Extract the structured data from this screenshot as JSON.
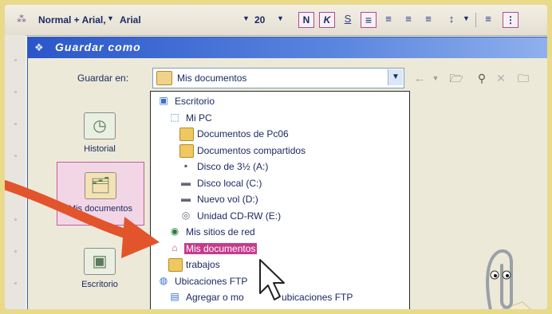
{
  "toolbar": {
    "style_label": "Normal + Arial,",
    "font_label": "Arial",
    "size_label": "20",
    "bold_label": "N",
    "italic_label": "K",
    "underline_label": "S",
    "icons": [
      "styles-icon",
      "align-left-icon",
      "align-center-icon",
      "align-right-icon",
      "justify-icon",
      "line-spacing-icon",
      "numbering-icon",
      "bullets-icon"
    ]
  },
  "dialog": {
    "title": "Guardar como",
    "save_in_label": "Guardar en:",
    "save_in_value": "Mis documentos",
    "toolbar_icons": [
      "back-icon",
      "up-folder-icon",
      "search-web-icon",
      "delete-icon",
      "new-folder-icon"
    ]
  },
  "places": [
    {
      "label": "Historial",
      "icon": "history-icon"
    },
    {
      "label": "Mis documentos",
      "icon": "my-documents-icon",
      "selected": true
    },
    {
      "label": "Escritorio",
      "icon": "desktop-icon"
    }
  ],
  "locations": [
    {
      "label": "Escritorio",
      "icon": "desktop-icon",
      "level": 0
    },
    {
      "label": "Mi PC",
      "icon": "computer-icon",
      "level": 1
    },
    {
      "label": "Documentos de Pc06",
      "icon": "folder-icon",
      "level": 2
    },
    {
      "label": "Documentos compartidos",
      "icon": "folder-icon",
      "level": 2
    },
    {
      "label": "Disco de 3½ (A:)",
      "icon": "floppy-icon",
      "level": 2
    },
    {
      "label": "Disco local (C:)",
      "icon": "hard-drive-icon",
      "level": 2
    },
    {
      "label": "Nuevo vol (D:)",
      "icon": "hard-drive-icon",
      "level": 2
    },
    {
      "label": "Unidad CD-RW (E:)",
      "icon": "cd-drive-icon",
      "level": 2
    },
    {
      "label": "Mis sitios de red",
      "icon": "network-icon",
      "level": 1
    },
    {
      "label": "Mis documentos",
      "icon": "my-documents-icon",
      "level": 1,
      "highlighted": true
    },
    {
      "label": "trabajos",
      "icon": "folder-icon",
      "level": 1
    },
    {
      "label": "Ubicaciones FTP",
      "icon": "ftp-icon",
      "level": 0
    },
    {
      "label": "Agregar o mo",
      "icon": "ftp-add-icon",
      "level": 1,
      "suffix": "ubicaciones FTP"
    }
  ],
  "colors": {
    "title_bar": "#2a56c9",
    "highlight": "#c63a8e",
    "arrow": "#e2542b"
  }
}
